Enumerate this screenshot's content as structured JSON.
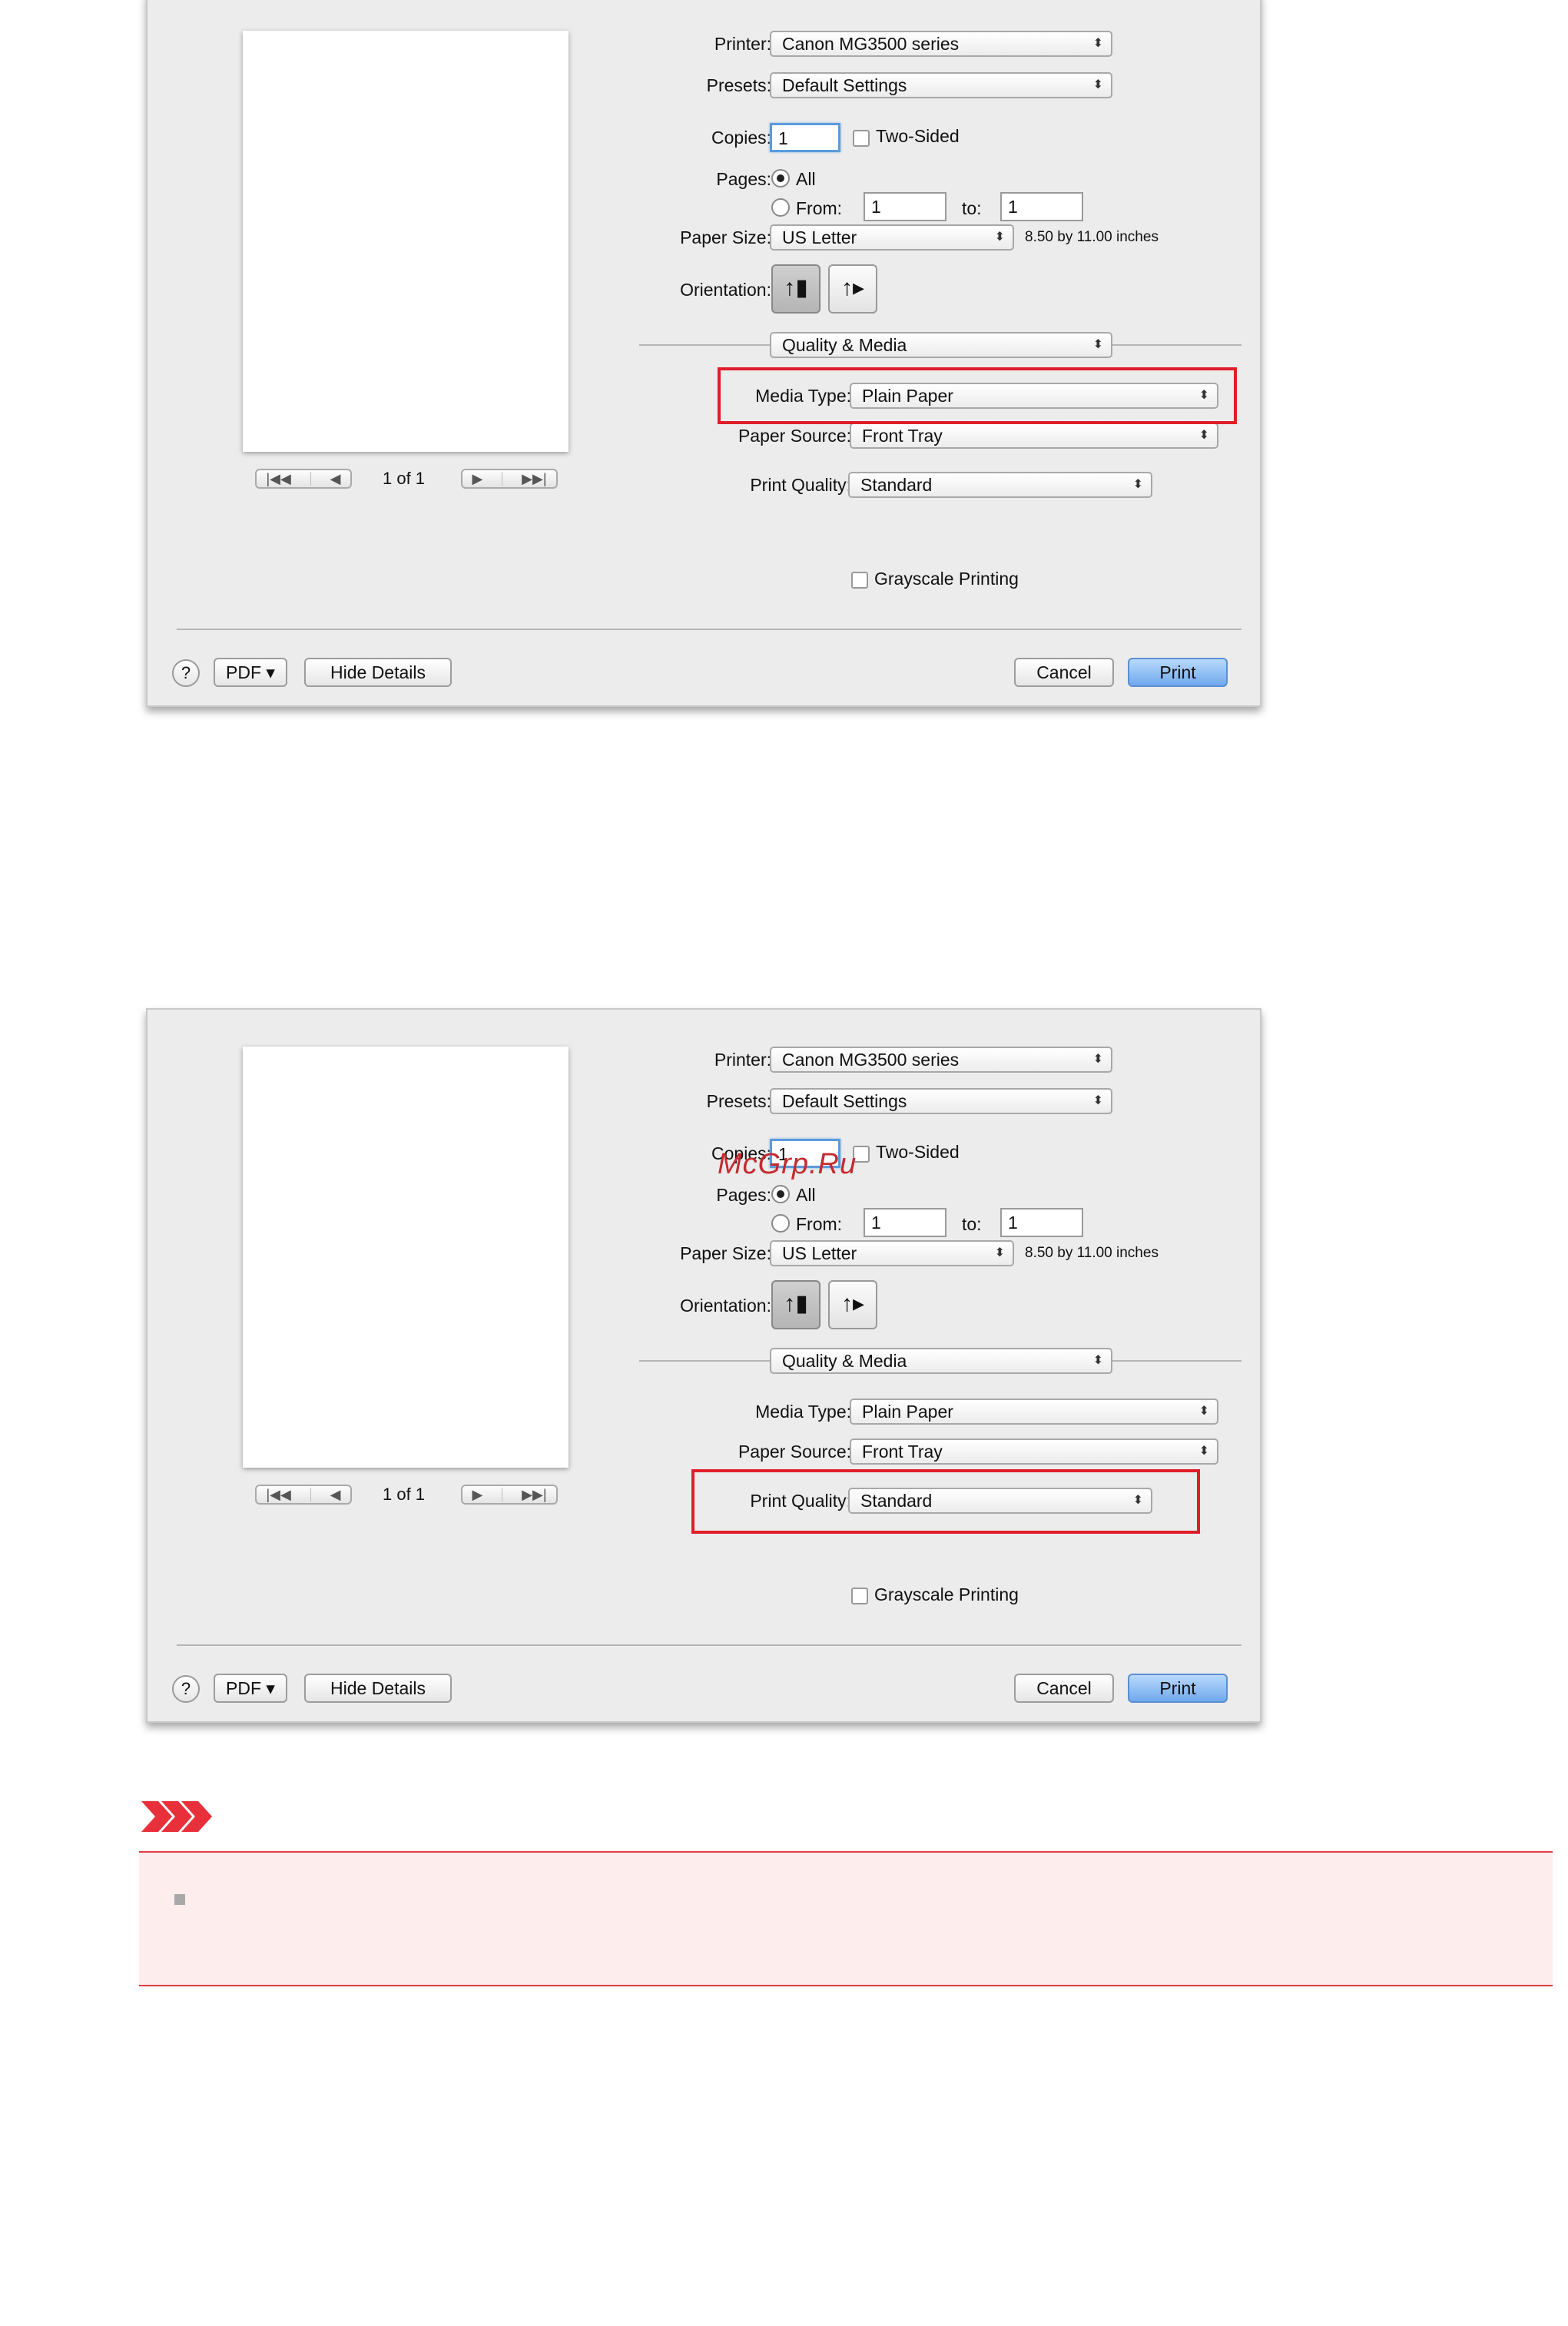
{
  "dialogs": [
    {
      "page_count": "1 of 1",
      "printer": {
        "label": "Printer:",
        "value": "Canon MG3500 series"
      },
      "presets": {
        "label": "Presets:",
        "value": "Default Settings"
      },
      "copies": {
        "label": "Copies:",
        "value": "1",
        "two_sided_label": "Two-Sided"
      },
      "pages": {
        "label": "Pages:",
        "all_label": "All",
        "from_label": "From:",
        "from_value": "1",
        "to_label": "to:",
        "to_value": "1"
      },
      "paper_size": {
        "label": "Paper Size:",
        "value": "US Letter",
        "dimensions": "8.50 by 11.00 inches"
      },
      "orientation": {
        "label": "Orientation:"
      },
      "panel": {
        "value": "Quality & Media"
      },
      "media_type": {
        "label": "Media Type:",
        "value": "Plain Paper"
      },
      "paper_source": {
        "label": "Paper Source:",
        "value": "Front Tray"
      },
      "print_quality": {
        "label": "Print Quality:",
        "value": "Standard"
      },
      "grayscale_label": "Grayscale Printing",
      "help_label": "?",
      "pdf_label": "PDF ▾",
      "hide_details_label": "Hide Details",
      "cancel_label": "Cancel",
      "print_label": "Print",
      "highlighted_setting": "Media Type"
    },
    {
      "page_count": "1 of 1",
      "printer": {
        "label": "Printer:",
        "value": "Canon MG3500 series"
      },
      "presets": {
        "label": "Presets:",
        "value": "Default Settings"
      },
      "copies": {
        "label": "Copies:",
        "value": "1",
        "two_sided_label": "Two-Sided"
      },
      "pages": {
        "label": "Pages:",
        "all_label": "All",
        "from_label": "From:",
        "from_value": "1",
        "to_label": "to:",
        "to_value": "1"
      },
      "paper_size": {
        "label": "Paper Size:",
        "value": "US Letter",
        "dimensions": "8.50 by 11.00 inches"
      },
      "orientation": {
        "label": "Orientation:"
      },
      "panel": {
        "value": "Quality & Media"
      },
      "media_type": {
        "label": "Media Type:",
        "value": "Plain Paper"
      },
      "paper_source": {
        "label": "Paper Source:",
        "value": "Front Tray"
      },
      "print_quality": {
        "label": "Print Quality:",
        "value": "Standard"
      },
      "grayscale_label": "Grayscale Printing",
      "help_label": "?",
      "pdf_label": "PDF ▾",
      "hide_details_label": "Hide Details",
      "cancel_label": "Cancel",
      "print_label": "Print",
      "highlighted_setting": "Print Quality"
    }
  ],
  "watermark": "McGrp.Ru",
  "colors": {
    "highlight": "#e01e2b",
    "important_bg": "#fdeded",
    "primary_button": "#6fa9ee"
  }
}
